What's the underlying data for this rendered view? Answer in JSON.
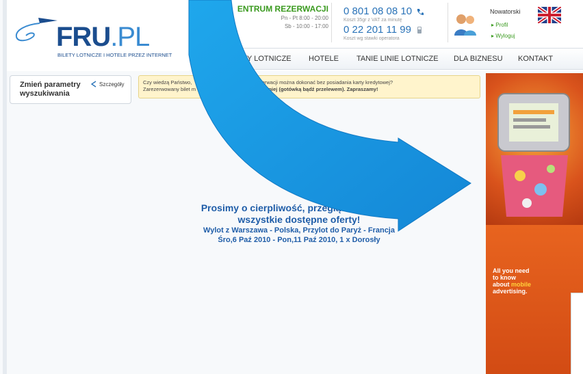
{
  "header": {
    "logo_text_main": "FRU",
    "logo_text_dot": ".PL",
    "logo_tagline": "BILETY LOTNICZE I HOTELE PRZEZ INTERNET",
    "center_title": "ENTRUM REZERWACJI",
    "center_hours_1": "Pn - Pt 8:00 - 20:00",
    "center_hours_2": "Sb - 10:00 - 17:00",
    "phone_1": "0 801 08 08 10",
    "phone_1_note": "Koszt 35gr z VAT za minutę",
    "phone_2": "0 22 201 11 99",
    "phone_2_note": "Koszt wg stawki operatora",
    "user_name": "Nowatorski",
    "link_profile": "▸ Profil",
    "link_logout": "▸ Wyloguj",
    "flag_lang": "EN"
  },
  "nav": {
    "items": [
      "ETY LOTNICZE",
      "HOTELE",
      "TANIE LINIE LOTNICZE",
      "DLA BIZNESU",
      "KONTAKT"
    ]
  },
  "params": {
    "label_1": "Zmień parametry",
    "label_2": "wyszukiwania",
    "details": "Szczegóły"
  },
  "info": {
    "line_1_a": "Czy wiedzą Państwo,",
    "line_1_b": "rezerwacji można dokonać bez posiadania karty kredytowej?",
    "line_2_a": "Zarezerwowany bilet m",
    "line_2_b": "óźniej (gotówką bądź przelewem). Zapraszamy!"
  },
  "search_status": {
    "line_1": "Prosimy o cierpliwość, przeglądamy dla Pa",
    "line_2": "wszystkie dostępne oferty!",
    "line_3": "Wylot z Warszawa - Polska, Przylot do Paryż - Francja",
    "line_4": "Śro,6 Paź 2010 - Pon,11 Paź 2010, 1 x Dorosły"
  },
  "ad": {
    "text_1": "All you need",
    "text_2": "to know",
    "text_3": "about ",
    "text_3_hl": "mobile",
    "text_4": "advertising."
  },
  "colors": {
    "brand_blue": "#1b4d8e",
    "link_green": "#3a9a1f",
    "arrow_blue": "#1e9ce6",
    "info_bg": "#fff4cc"
  }
}
